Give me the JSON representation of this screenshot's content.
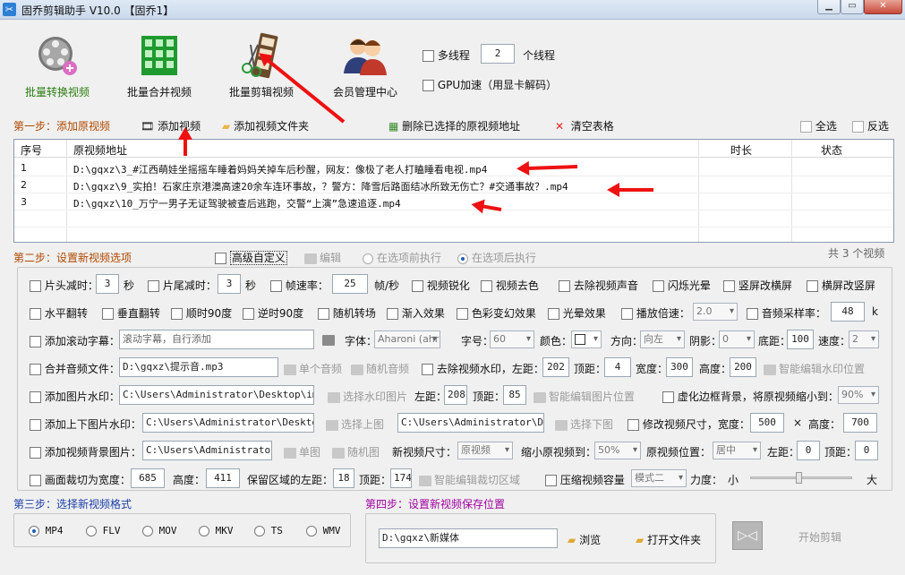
{
  "window": {
    "title": "固乔剪辑助手 V10.0 【固乔1】"
  },
  "toolbar": {
    "convert": "批量转换视频",
    "merge": "批量合并视频",
    "edit": "批量剪辑视频",
    "member": "会员管理中心",
    "multithread": "多线程",
    "threads": "2",
    "threads_unit": "个线程",
    "gpu": "GPU加速（用显卡解码）"
  },
  "step1": {
    "label": "第一步：添加原视频",
    "add_video": "添加视频",
    "add_folder": "添加视频文件夹",
    "delete_selected": "删除已选择的原视频地址",
    "clear": "清空表格",
    "select_all": "全选",
    "invert": "反选"
  },
  "table": {
    "headers": [
      "序号",
      "原视频地址",
      "时长",
      "状态"
    ],
    "rows": [
      {
        "n": "1",
        "path": "D:\\gqxz\\3_#江西萌娃坐摇摇车睡着妈妈关掉车后秒醒，网友：像极了老人打瞌睡看电视.mp4"
      },
      {
        "n": "2",
        "path": "D:\\gqxz\\9_实拍！石家庄京港澳高速20余车连环事故，？警方：降雪后路面结冰所致无伤亡？#交通事故？.mp4"
      },
      {
        "n": "3",
        "path": "D:\\gqxz\\10_万宁一男子无证驾驶被查后逃跑，交警“上演”急速追逐.mp4"
      }
    ],
    "count": "共 3 个视频"
  },
  "step2": {
    "label": "第二步：设置新视频选项",
    "advanced": "高级自定义",
    "edit": "编辑",
    "before_opt": "在选项前执行",
    "after_opt": "在选项后执行",
    "r1": {
      "head_cut": "片头减时：",
      "head_val": "3",
      "sec": "秒",
      "tail_cut": "片尾减时：",
      "tail_val": "3",
      "sec2": "秒",
      "fps": "帧速率：",
      "fps_val": "25",
      "fps_unit": "帧/秒",
      "sharpen": "视频锐化",
      "decolor": "视频去色",
      "mute": "去除视频声音",
      "flash": "闪烁光晕",
      "v2h": "竖屏改横屏",
      "h2v": "横屏改竖屏"
    },
    "r2": {
      "hflip": "水平翻转",
      "vflip": "垂直翻转",
      "cw90": "顺时90度",
      "ccw90": "逆时90度",
      "rand_trans": "随机转场",
      "fade_in": "渐入效果",
      "color_fx": "色彩变幻效果",
      "halo": "光晕效果",
      "speed": "播放倍速：",
      "speed_val": "2.0",
      "sample": "音频采样率：",
      "sample_val": "48",
      "sample_unit": "k"
    },
    "r3": {
      "scroll": "添加滚动字幕：",
      "scroll_ph": "滚动字幕，自行添加",
      "font": "字体：",
      "font_val": "Aharoni (ahr",
      "size": "字号：",
      "size_val": "60",
      "color": "颜色：",
      "dir": "方向：",
      "dir_val": "向左",
      "shadow": "阴影：",
      "shadow_val": "0",
      "bottom": "底距：",
      "bottom_val": "100",
      "speed": "速度：",
      "speed_val": "2"
    },
    "r4": {
      "merge_audio": "合并音频文件：",
      "audio_path": "D:\\gqxz\\提示音.mp3",
      "single": "单个音频",
      "random": "随机音频",
      "remove_wm": "去除视频水印，左距：",
      "left_val": "202",
      "top": "顶距：",
      "top_val": "4",
      "width": "宽度：",
      "width_val": "300",
      "height": "高度：",
      "height_val": "200",
      "smart": "智能编辑水印位置"
    },
    "r5": {
      "img_wm": "添加图片水印：",
      "img_path": "C:\\Users\\Administrator\\Desktop\\img-q",
      "choose": "选择水印图片",
      "left": "左距：",
      "left_val": "208",
      "top": "顶距：",
      "top_val": "85",
      "smart": "智能编辑图片位置",
      "blur": "虚化边框背景，将原视频缩小到：",
      "blur_val": "90%"
    },
    "r6": {
      "tb_img": "添加上下图片水印：",
      "top_path": "C:\\Users\\Administrator\\Desktop\\i",
      "choose_top": "选择上图",
      "bottom_path": "C:\\Users\\Administrator\\Desk",
      "choose_bottom": "选择下图",
      "resize": "修改视频尺寸，宽度：",
      "w_val": "500",
      "x": "×",
      "height": "高度：",
      "h_val": "700"
    },
    "r7": {
      "bg_img": "添加视频背景图片：",
      "bg_path": "C:\\Users\\Administrator\\D",
      "single": "单图",
      "random": "随机图",
      "new_size": "新视频尺寸：",
      "new_size_val": "原视频",
      "shrink": "缩小原视频到：",
      "shrink_val": "50%",
      "pos": "原视频位置：",
      "pos_val": "居中",
      "left": "左距：",
      "left_val": "0",
      "top": "顶距：",
      "top_val": "0"
    },
    "r8": {
      "crop": "画面裁切为宽度：",
      "w_val": "685",
      "height": "高度：",
      "h_val": "411",
      "keep": "保留区域的左距：",
      "left_val": "18",
      "top": "顶距：",
      "top_val": "174",
      "smart": "智能编辑裁切区域",
      "compress": "压缩视频容量",
      "mode_val": "模式二",
      "force": "力度：",
      "small": "小",
      "big": "大"
    }
  },
  "step3": {
    "label": "第三步：选择新视频格式",
    "formats": [
      "MP4",
      "FLV",
      "MOV",
      "MKV",
      "TS",
      "WMV"
    ]
  },
  "step4": {
    "label": "第四步：设置新视频保存位置",
    "path": "D:\\gqxz\\新媒体",
    "browse": "浏览",
    "open_folder": "打开文件夹",
    "start": "开始剪辑"
  }
}
